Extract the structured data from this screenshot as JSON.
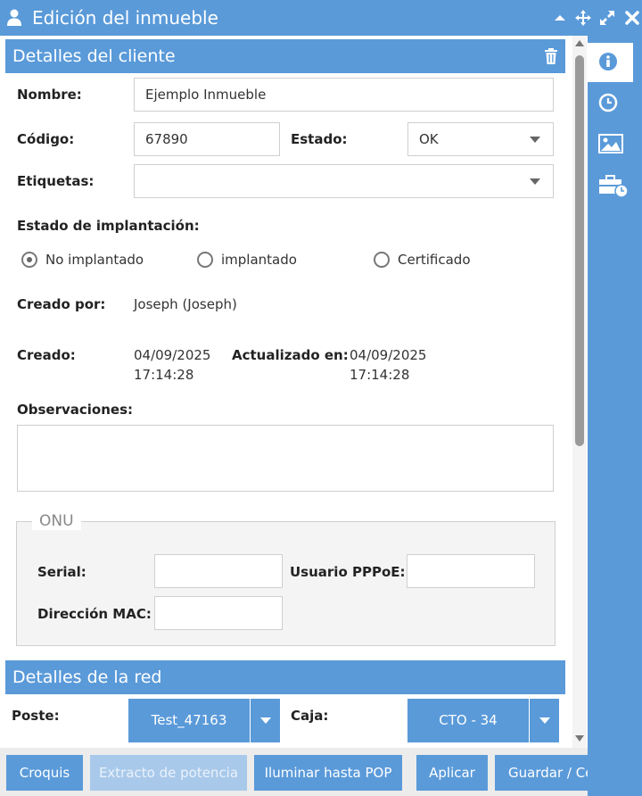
{
  "window": {
    "title": "Edición del inmueble"
  },
  "client_section": {
    "title": "Detalles del cliente",
    "name_label": "Nombre:",
    "name_value": "Ejemplo Inmueble",
    "code_label": "Código:",
    "code_value": "67890",
    "status_label": "Estado:",
    "status_value": "OK",
    "tags_label": "Etiquetas:",
    "tags_value": "",
    "impl_label": "Estado de implantación:",
    "impl_options": [
      {
        "label": "No implantado",
        "checked": true
      },
      {
        "label": "implantado",
        "checked": false
      },
      {
        "label": "Certificado",
        "checked": false
      }
    ],
    "created_by_label": "Creado por:",
    "created_by_value": "Joseph (Joseph)",
    "created_label": "Creado:",
    "created_date": "04/09/2025",
    "created_time": "17:14:28",
    "updated_label": "Actualizado en:",
    "updated_date": "04/09/2025",
    "updated_time": "17:14:28",
    "notes_label": "Observaciones:"
  },
  "onu": {
    "legend": "ONU",
    "serial_label": "Serial:",
    "pppoe_label": "Usuario PPPoE:",
    "mac_label": "Dirección MAC:"
  },
  "network_section": {
    "title": "Detalles de la red",
    "pole_label": "Poste:",
    "pole_value": "Test_47163",
    "box_label": "Caja:",
    "box_value": "CTO - 34"
  },
  "footer": {
    "buttons": [
      {
        "label": "Croquis",
        "disabled": false
      },
      {
        "label": "Extracto de potencia",
        "disabled": true
      },
      {
        "label": "Iluminar hasta POP",
        "disabled": false
      },
      {
        "label": "Aplicar",
        "disabled": false
      },
      {
        "label": "Guardar / Ce",
        "disabled": false
      }
    ]
  },
  "colors": {
    "accent": "#5a9ad9",
    "disabled": "#a9c9ea"
  },
  "icons": [
    "user-icon",
    "collapse-icon",
    "move-icon",
    "maximize-icon",
    "close-icon",
    "trash-icon",
    "info-icon",
    "clock-icon",
    "image-icon",
    "briefcase-clock-icon"
  ]
}
